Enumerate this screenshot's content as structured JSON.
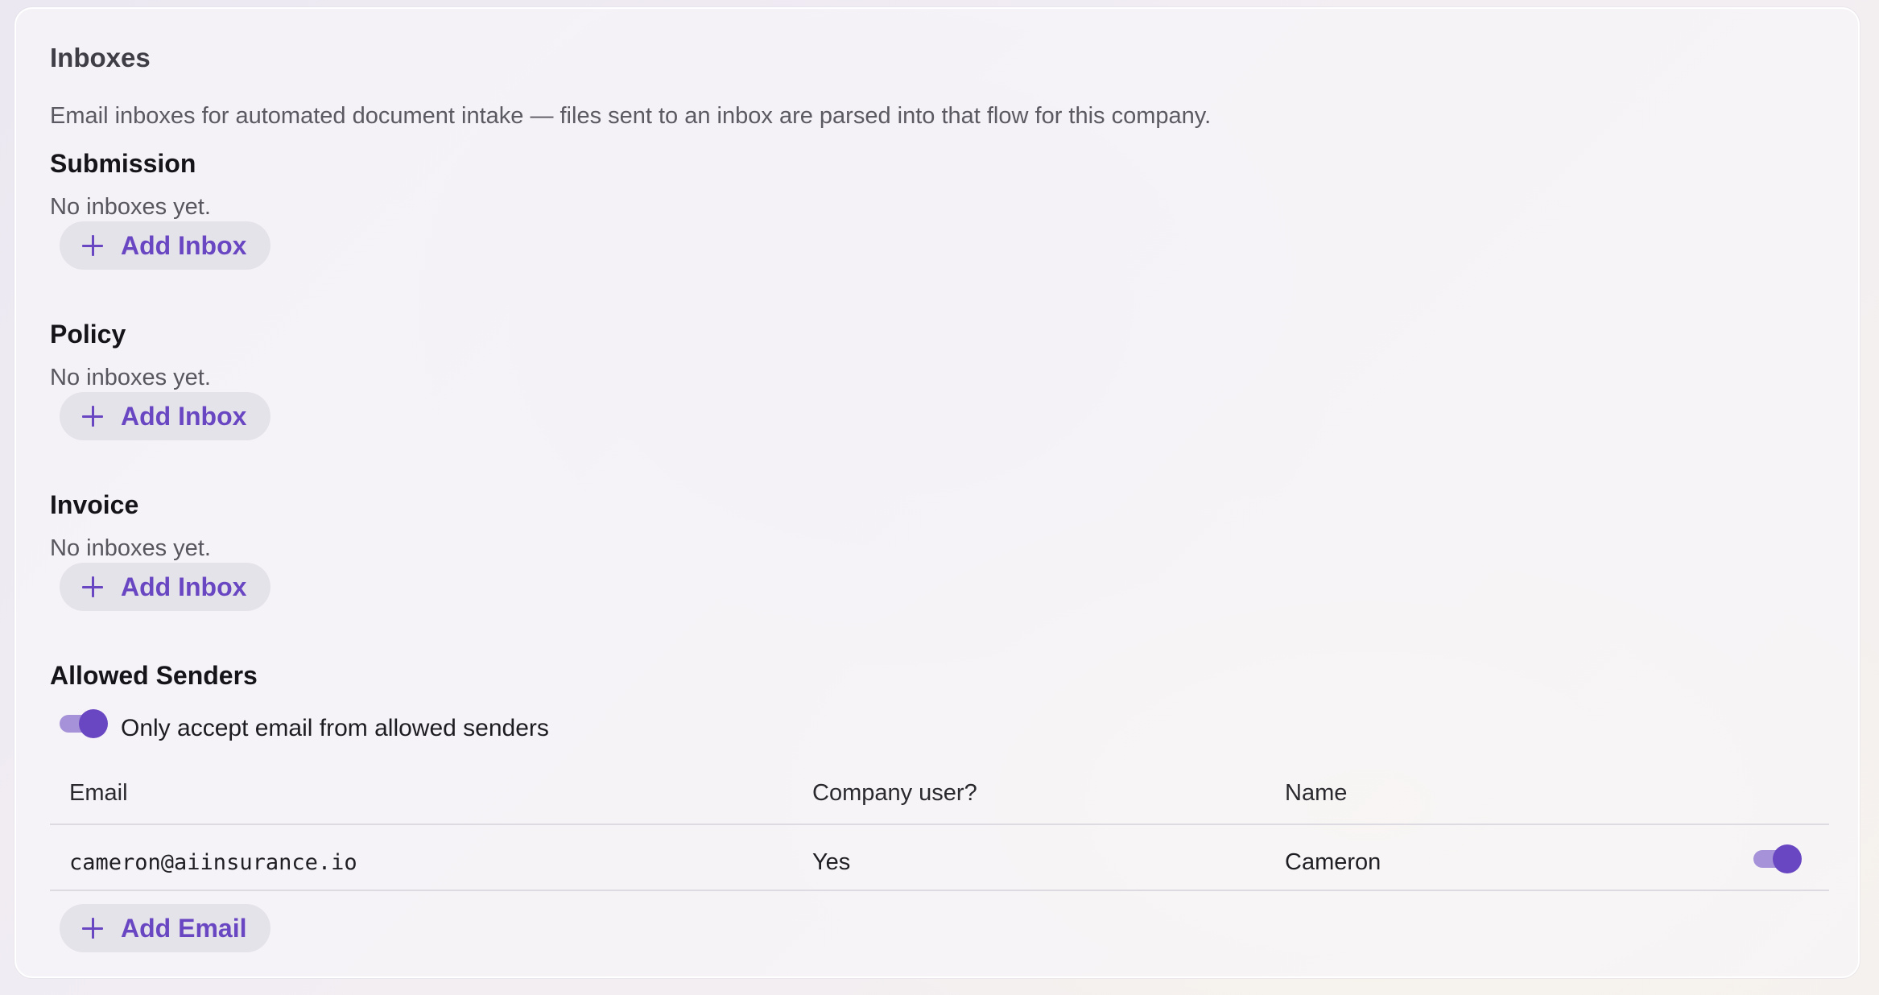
{
  "card": {
    "title": "Inboxes",
    "description": "Email inboxes for automated document intake — files sent to an inbox are parsed into that flow for this company."
  },
  "sections": [
    {
      "heading": "Submission",
      "empty_text": "No inboxes yet.",
      "button_label": "Add Inbox"
    },
    {
      "heading": "Policy",
      "empty_text": "No inboxes yet.",
      "button_label": "Add Inbox"
    },
    {
      "heading": "Invoice",
      "empty_text": "No inboxes yet.",
      "button_label": "Add Inbox"
    }
  ],
  "allowed_senders": {
    "heading": "Allowed Senders",
    "restrict_toggle_label": "Only accept email from allowed senders",
    "restrict_toggle_on": true,
    "columns": [
      "Email",
      "Company user?",
      "Name"
    ],
    "rows": [
      {
        "email": "cameron@aiinsurance.io",
        "company_user": "Yes",
        "name": "Cameron",
        "enabled": true
      }
    ],
    "add_button_label": "Add Email"
  },
  "colors": {
    "accent": "#6a47c2",
    "accent_light": "#a592d8",
    "button_bg": "#e5e3ea"
  },
  "icons": {
    "add": "plus-icon"
  }
}
